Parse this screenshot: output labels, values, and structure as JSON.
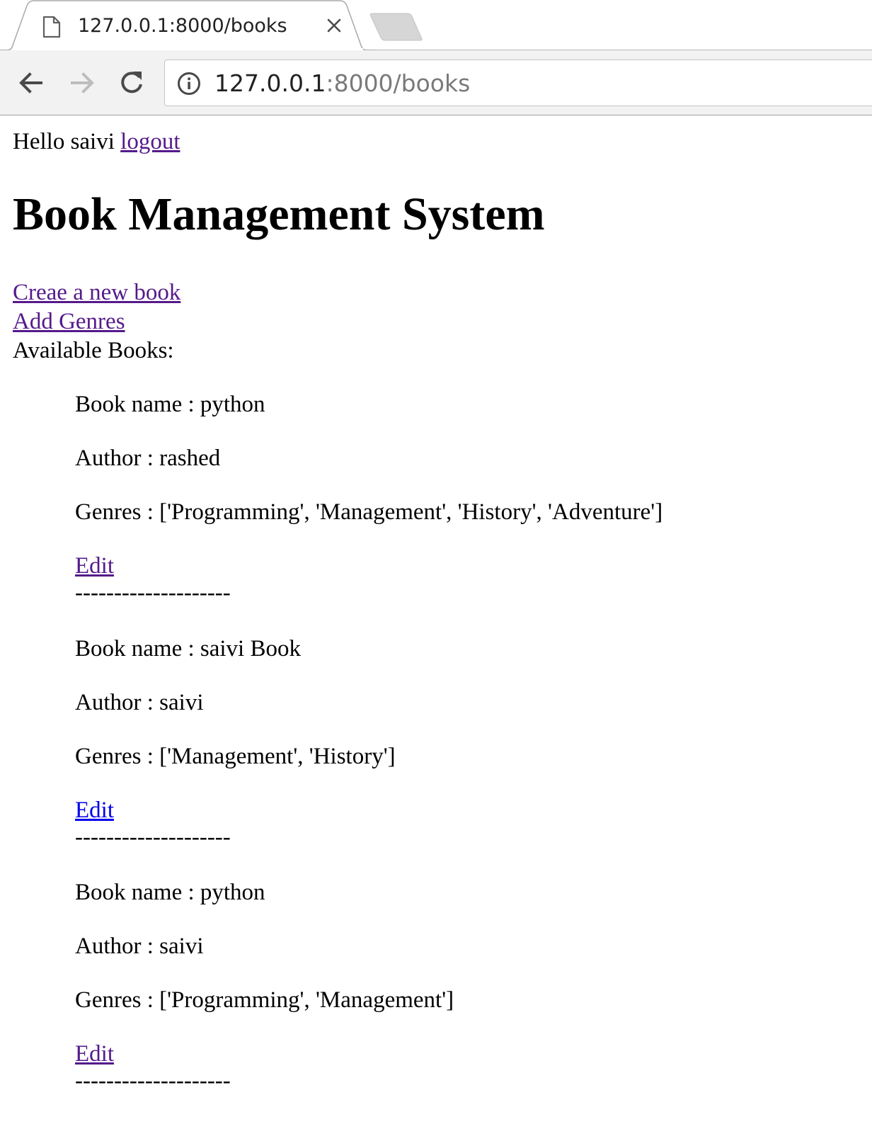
{
  "browser": {
    "tab_title": "127.0.0.1:8000/books",
    "url_host": "127.0.0.1",
    "url_path": ":8000/books"
  },
  "header": {
    "greeting": "Hello saivi",
    "logout_label": "logout"
  },
  "page_title": "Book Management System",
  "nav": {
    "create_book_label": "Creae a new book",
    "add_genres_label": "Add Genres",
    "available_books_label": "Available Books:"
  },
  "books": [
    {
      "name": "Book name : python",
      "author": "Author : rashed",
      "genres": "Genres : ['Programming', 'Management', 'History', 'Adventure']",
      "edit_label": "Edit",
      "separator": "--------------------"
    },
    {
      "name": "Book name : saivi Book",
      "author": "Author : saivi",
      "genres": "Genres : ['Management', 'History']",
      "edit_label": "Edit",
      "separator": "--------------------"
    },
    {
      "name": "Book name : python",
      "author": "Author : saivi",
      "genres": "Genres : ['Programming', 'Management']",
      "edit_label": "Edit",
      "separator": "--------------------"
    }
  ]
}
